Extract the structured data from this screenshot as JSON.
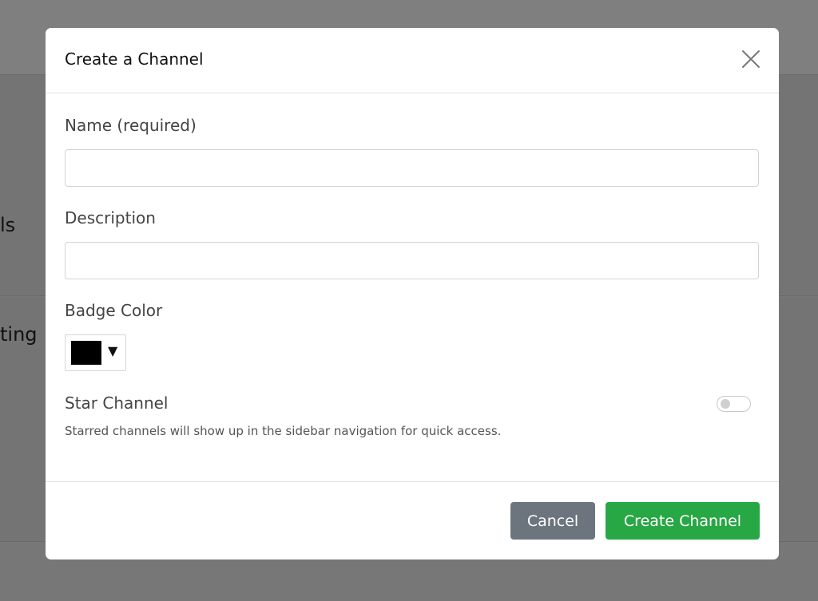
{
  "background": {
    "text_1": "ls",
    "text_2": "ting"
  },
  "modal": {
    "title": "Create a Channel",
    "close_icon": "close-icon",
    "name": {
      "label": "Name (required)",
      "value": "",
      "placeholder": ""
    },
    "description": {
      "label": "Description",
      "value": "",
      "placeholder": ""
    },
    "badge_color": {
      "label": "Badge Color",
      "value": "#000000",
      "caret": "▼"
    },
    "star_channel": {
      "label": "Star Channel",
      "enabled": false,
      "help": "Starred channels will show up in the sidebar navigation for quick access."
    },
    "footer": {
      "cancel_label": "Cancel",
      "create_label": "Create Channel"
    }
  },
  "colors": {
    "cancel_button": "#6c757d",
    "create_button": "#28a745",
    "badge_swatch": "#000000"
  }
}
